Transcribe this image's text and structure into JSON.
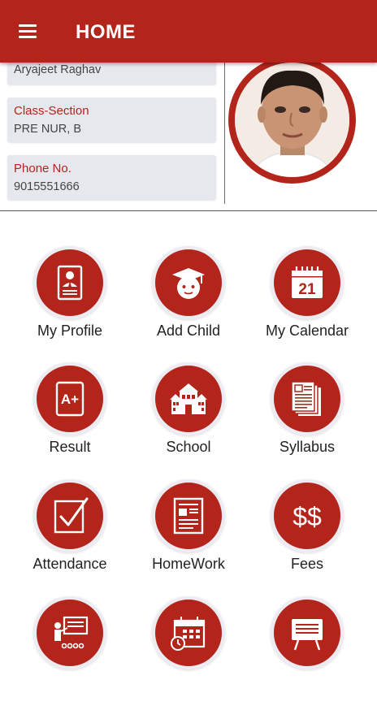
{
  "app_bar": {
    "title": "HOME",
    "menu_icon": "hamburger-menu-icon",
    "color": "#b3241b"
  },
  "profile": {
    "name_value": "Aryajeet Raghav",
    "class_section": {
      "label": "Class-Section",
      "value": "PRE NUR, B"
    },
    "phone": {
      "label": "Phone No.",
      "value": "9015551666"
    }
  },
  "menu": [
    {
      "label": "My Profile",
      "icon": "profile-card-icon"
    },
    {
      "label": "Add Child",
      "icon": "graduation-cap-icon"
    },
    {
      "label": "My Calendar",
      "icon": "calendar-icon",
      "calendar_day": "21"
    },
    {
      "label": "Result",
      "icon": "grade-paper-icon",
      "grade": "A+"
    },
    {
      "label": "School",
      "icon": "school-building-icon"
    },
    {
      "label": "Syllabus",
      "icon": "documents-icon"
    },
    {
      "label": "Attendance",
      "icon": "checkmark-icon"
    },
    {
      "label": "HomeWork",
      "icon": "homework-sheet-icon"
    },
    {
      "label": "Fees",
      "icon": "fees-icon",
      "symbol": "$$"
    },
    {
      "label": "",
      "icon": "teacher-board-icon"
    },
    {
      "label": "",
      "icon": "timetable-icon"
    },
    {
      "label": "",
      "icon": "notice-board-icon"
    }
  ]
}
